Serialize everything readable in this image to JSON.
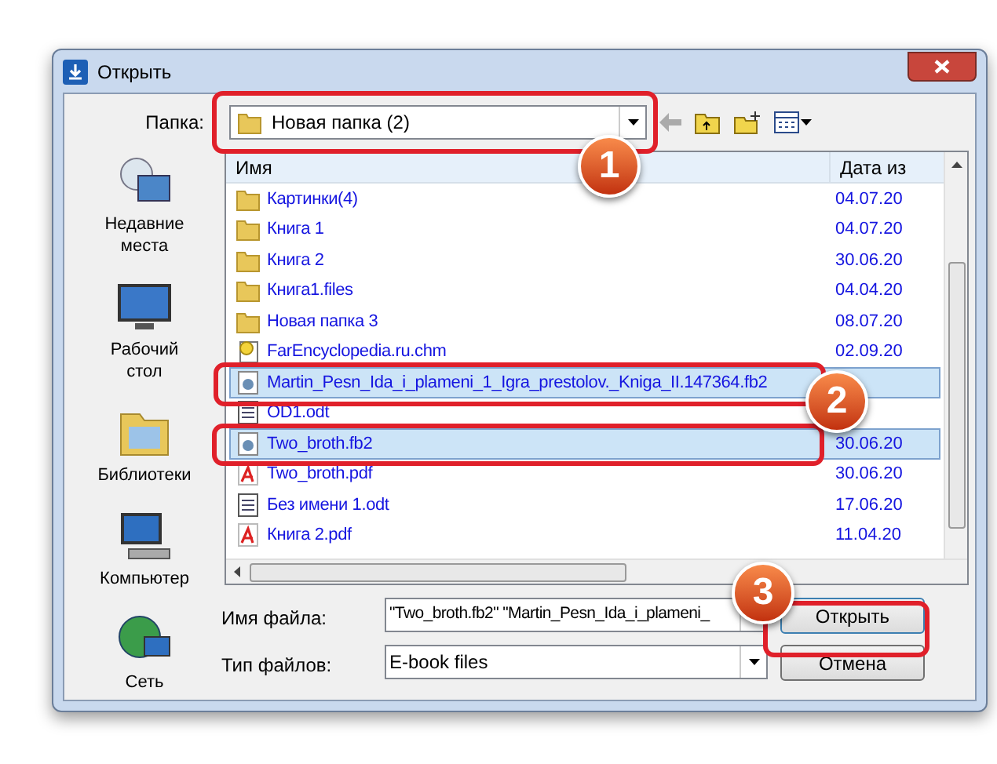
{
  "window": {
    "title": "Открыть"
  },
  "folder": {
    "label": "Папка:",
    "value": "Новая папка (2)"
  },
  "sidebar": {
    "items": [
      {
        "label": "Недавние места",
        "kind": "recent"
      },
      {
        "label": "Рабочий стол",
        "kind": "desktop"
      },
      {
        "label": "Библиотеки",
        "kind": "libraries"
      },
      {
        "label": "Компьютер",
        "kind": "computer"
      },
      {
        "label": "Сеть",
        "kind": "network"
      }
    ]
  },
  "table": {
    "columns": [
      "Имя",
      "Дата из"
    ],
    "rows": [
      {
        "name": "Картинки(4)",
        "date": "04.07.20",
        "kind": "folder",
        "selected": false
      },
      {
        "name": "Книга 1",
        "date": "04.07.20",
        "kind": "folder",
        "selected": false
      },
      {
        "name": "Книга 2",
        "date": "30.06.20",
        "kind": "folder",
        "selected": false
      },
      {
        "name": "Книга1.files",
        "date": "04.04.20",
        "kind": "folder",
        "selected": false
      },
      {
        "name": "Новая папка 3",
        "date": "08.07.20",
        "kind": "folder",
        "selected": false
      },
      {
        "name": "FarEncyclopedia.ru.chm",
        "date": "02.09.20",
        "kind": "chm",
        "selected": false
      },
      {
        "name": "Martin_Pesn_Ida_i_plameni_1_Igra_prestolov._Kniga_II.147364.fb2",
        "kind": "fb2",
        "selected": true
      },
      {
        "name": "OD1.odt",
        "kind": "odt",
        "selected": false
      },
      {
        "name": "Two_broth.fb2",
        "date": "30.06.20",
        "kind": "fb2",
        "selected": true
      },
      {
        "name": "Two_broth.pdf",
        "date": "30.06.20",
        "kind": "pdf",
        "selected": false
      },
      {
        "name": "Без имени 1.odt",
        "date": "17.06.20",
        "kind": "odt",
        "selected": false
      },
      {
        "name": "Книга 2.pdf",
        "date": "11.04.20",
        "kind": "pdf",
        "selected": false
      }
    ]
  },
  "file_name": {
    "label": "Имя файла:",
    "value": "\"Two_broth.fb2\" \"Martin_Pesn_Ida_i_plameni_"
  },
  "file_type": {
    "label": "Тип файлов:",
    "value": "E-book files"
  },
  "buttons": [
    "Открыть",
    "Отмена"
  ],
  "callouts": [
    "1",
    "2",
    "3"
  ]
}
